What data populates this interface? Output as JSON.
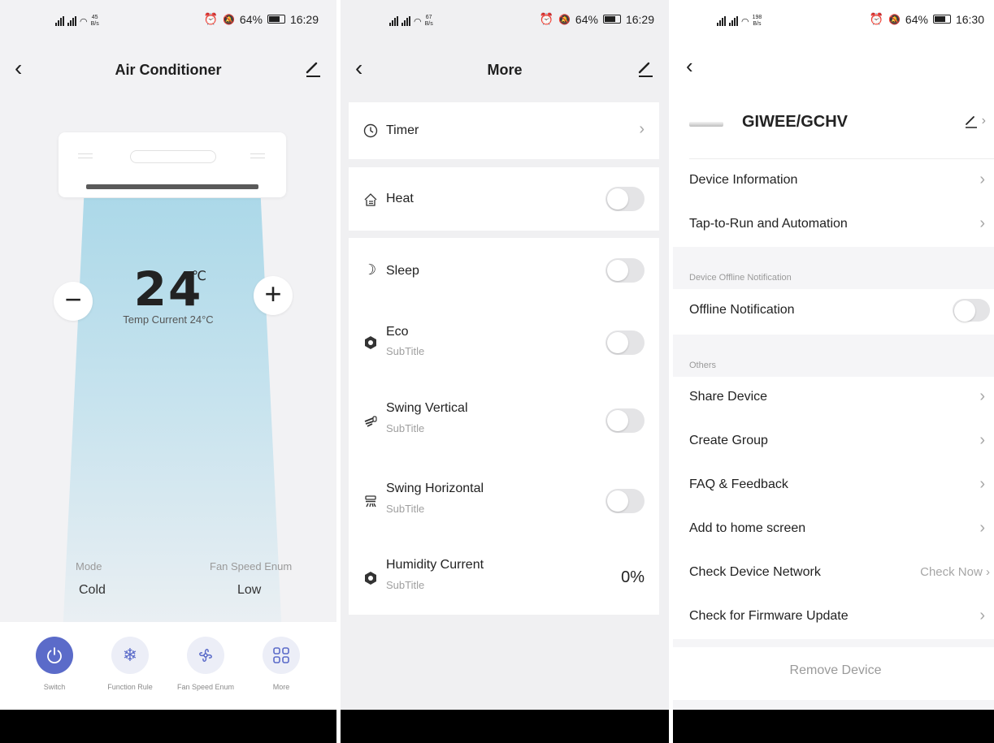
{
  "screens": {
    "main": {
      "status": {
        "rate": "45",
        "rate_unit": "B/s",
        "battery": "64%",
        "time": "16:29"
      },
      "title": "Air Conditioner",
      "temperature": {
        "value": "24",
        "unit": "℃",
        "current_label": "Temp Current 24°C"
      },
      "mode": {
        "label": "Mode",
        "value": "Cold"
      },
      "fan": {
        "label": "Fan Speed Enum",
        "value": "Low"
      },
      "bottom": [
        {
          "label": "Switch",
          "icon": "power-icon"
        },
        {
          "label": "Function Rule",
          "icon": "snowflake-icon"
        },
        {
          "label": "Fan Speed Enum",
          "icon": "fan-icon"
        },
        {
          "label": "More",
          "icon": "grid-icon"
        }
      ]
    },
    "more": {
      "status": {
        "rate": "67",
        "rate_unit": "B/s",
        "battery": "64%",
        "time": "16:29"
      },
      "title": "More",
      "rows": [
        {
          "title": "Timer",
          "icon": "clock-icon",
          "control": "chevron"
        },
        {
          "title": "Heat",
          "icon": "heater-icon",
          "control": "toggle",
          "state": "off"
        },
        {
          "title": "Sleep",
          "icon": "moon-icon",
          "control": "toggle",
          "state": "off"
        },
        {
          "title": "Eco",
          "subtitle": "SubTitle",
          "icon": "eco-icon",
          "control": "toggle",
          "state": "off"
        },
        {
          "title": "Swing Vertical",
          "subtitle": "SubTitle",
          "icon": "swing-vertical-icon",
          "control": "toggle",
          "state": "off"
        },
        {
          "title": "Swing Horizontal",
          "subtitle": "SubTitle",
          "icon": "swing-horizontal-icon",
          "control": "toggle",
          "state": "off"
        },
        {
          "title": "Humidity Current",
          "subtitle": "SubTitle",
          "icon": "humidity-icon",
          "control": "value",
          "value": "0%"
        }
      ]
    },
    "settings": {
      "status": {
        "rate": "198",
        "rate_unit": "B/s",
        "battery": "64%",
        "time": "16:30"
      },
      "device_name": "GIWEE/GCHV",
      "rows": [
        {
          "label": "Device Information"
        },
        {
          "label": "Tap-to-Run and Automation"
        }
      ],
      "offline_section": "Device Offline Notification",
      "offline_label": "Offline Notification",
      "others_section": "Others",
      "others": [
        {
          "label": "Share Device"
        },
        {
          "label": "Create Group"
        },
        {
          "label": "FAQ & Feedback"
        },
        {
          "label": "Add to home screen"
        },
        {
          "label": "Check Device Network",
          "right": "Check Now"
        },
        {
          "label": "Check for Firmware Update"
        }
      ],
      "remove_label": "Remove Device"
    }
  },
  "colors": {
    "accent": "#5b6bc9",
    "toggle_off": "#e4e4e6",
    "airflow": "#a8d7e8"
  }
}
